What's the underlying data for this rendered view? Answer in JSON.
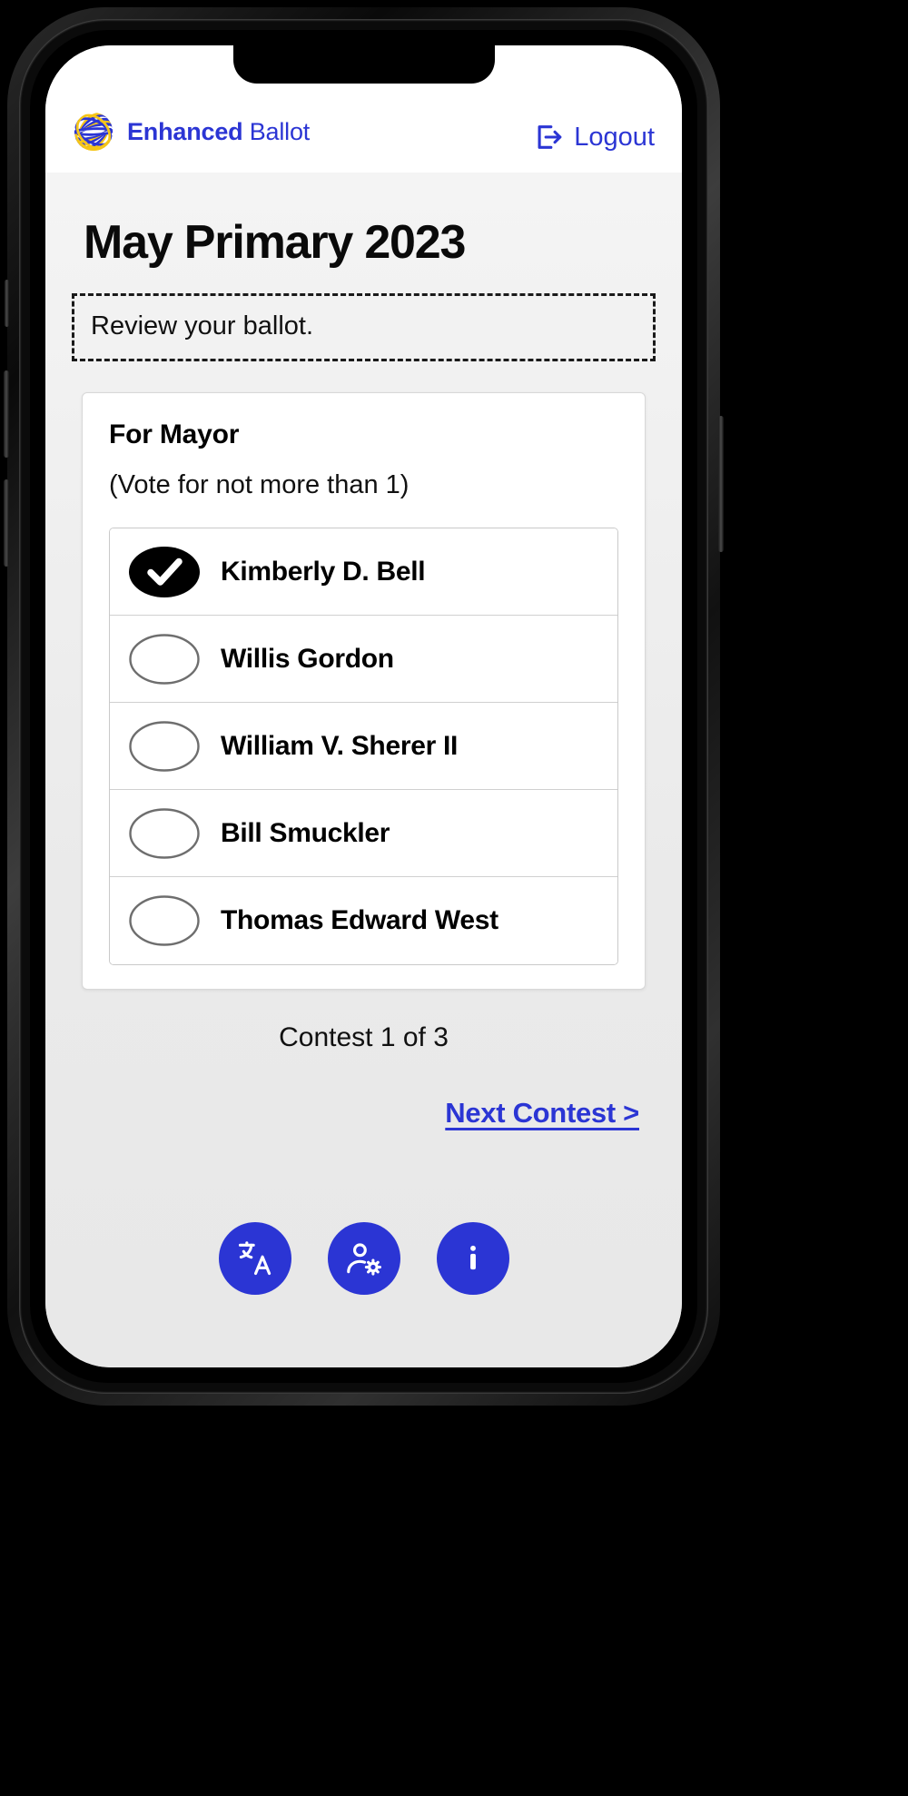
{
  "app": {
    "brand_bold": "Enhanced",
    "brand_light": "Ballot",
    "logout_label": "Logout",
    "brand_color": "#2b35d4",
    "logo_colors": [
      "#2b35d4",
      "#f5c518",
      "#ffffff"
    ]
  },
  "page": {
    "election_title": "May Primary 2023",
    "instruction": "Review your ballot."
  },
  "contest": {
    "title": "For Mayor",
    "rule": "(Vote for not more than 1)",
    "options": [
      {
        "name": "Kimberly D. Bell",
        "selected": true
      },
      {
        "name": "Willis Gordon",
        "selected": false
      },
      {
        "name": "William V. Sherer II",
        "selected": false
      },
      {
        "name": "Bill Smuckler",
        "selected": false
      },
      {
        "name": "Thomas Edward West",
        "selected": false
      }
    ]
  },
  "footer": {
    "counter": "Contest 1 of 3",
    "next_label": "Next Contest >",
    "tools": [
      {
        "icon": "translate-icon",
        "label": "Language"
      },
      {
        "icon": "accessibility-settings-icon",
        "label": "Accessibility settings"
      },
      {
        "icon": "info-icon",
        "label": "Information"
      }
    ]
  }
}
